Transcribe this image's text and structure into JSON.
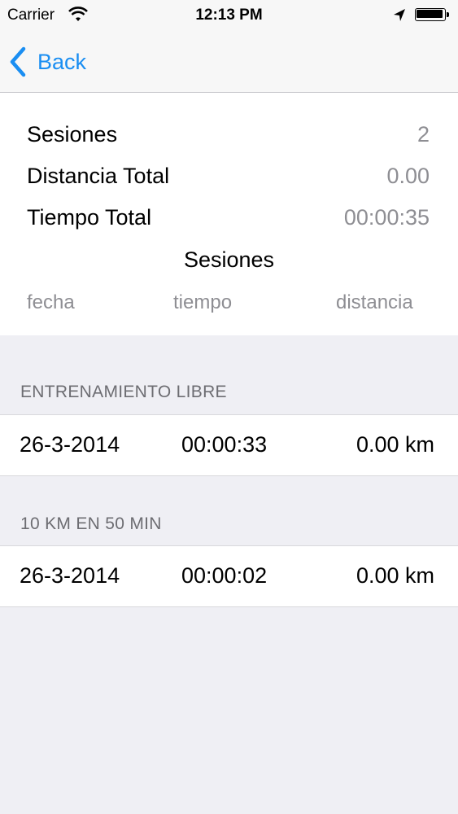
{
  "status_bar": {
    "carrier": "Carrier",
    "time": "12:13 PM"
  },
  "nav": {
    "back_label": "Back",
    "accent_color": "#1a8ef2"
  },
  "summary": {
    "rows": [
      {
        "label": "Sesiones",
        "value": "2"
      },
      {
        "label": "Distancia Total",
        "value": "0.00"
      },
      {
        "label": "Tiempo Total",
        "value": "00:00:35"
      }
    ],
    "title": "Sesiones",
    "columns": [
      "fecha",
      "tiempo",
      "distancia"
    ]
  },
  "sections": [
    {
      "header": "ENTRENAMIENTO LIBRE",
      "rows": [
        {
          "date": "26-3-2014",
          "time": "00:00:33",
          "distance": "0.00 km"
        }
      ]
    },
    {
      "header": "10 KM EN 50 MIN",
      "rows": [
        {
          "date": "26-3-2014",
          "time": "00:00:02",
          "distance": "0.00 km"
        }
      ]
    }
  ]
}
